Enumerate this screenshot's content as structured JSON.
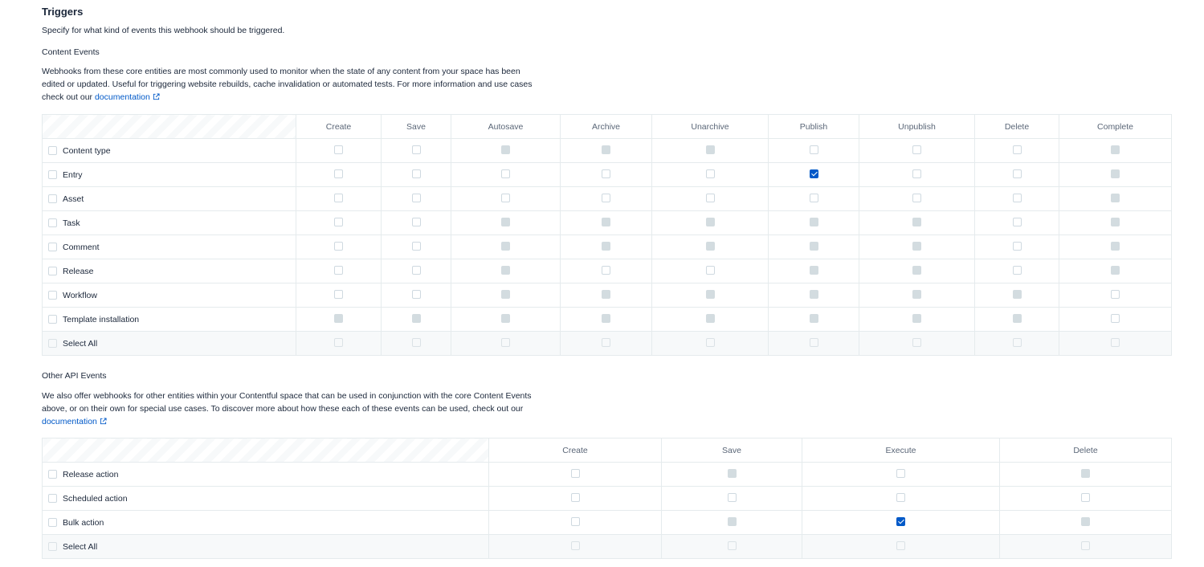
{
  "triggers": {
    "title": "Triggers",
    "subtitle": "Specify for what kind of events this webhook should be triggered."
  },
  "content_events": {
    "title": "Content Events",
    "description": "Webhooks from these core entities are most commonly used to monitor when the state of any content from your space has been edited or updated. Useful for triggering website rebuilds, cache invalidation or automated tests. For more information and use cases check out our",
    "link_label": "documentation",
    "columns": [
      "Create",
      "Save",
      "Autosave",
      "Archive",
      "Unarchive",
      "Publish",
      "Unpublish",
      "Delete",
      "Complete"
    ],
    "rows": [
      {
        "label": "Content type",
        "cells": [
          "off",
          "off",
          "disabled",
          "disabled",
          "disabled",
          "off",
          "off",
          "off",
          "disabled"
        ]
      },
      {
        "label": "Entry",
        "cells": [
          "off",
          "off",
          "off",
          "off",
          "off",
          "checked",
          "off",
          "off",
          "disabled"
        ]
      },
      {
        "label": "Asset",
        "cells": [
          "off",
          "off",
          "off",
          "off",
          "off",
          "off",
          "off",
          "off",
          "disabled"
        ]
      },
      {
        "label": "Task",
        "cells": [
          "off",
          "off",
          "disabled",
          "disabled",
          "disabled",
          "disabled",
          "disabled",
          "off",
          "disabled"
        ]
      },
      {
        "label": "Comment",
        "cells": [
          "off",
          "off",
          "disabled",
          "disabled",
          "disabled",
          "disabled",
          "disabled",
          "off",
          "disabled"
        ]
      },
      {
        "label": "Release",
        "cells": [
          "off",
          "off",
          "disabled",
          "off",
          "off",
          "disabled",
          "disabled",
          "off",
          "disabled"
        ]
      },
      {
        "label": "Workflow",
        "cells": [
          "off",
          "off",
          "disabled",
          "disabled",
          "disabled",
          "disabled",
          "disabled",
          "disabled",
          "off"
        ]
      },
      {
        "label": "Template installation",
        "cells": [
          "disabled",
          "disabled",
          "disabled",
          "disabled",
          "disabled",
          "disabled",
          "disabled",
          "disabled",
          "off"
        ]
      }
    ],
    "select_all_label": "Select All"
  },
  "other_events": {
    "title": "Other API Events",
    "description": "We also offer webhooks for other entities within your Contentful space that can be used in conjunction with the core Content Events above, or on their own for special use cases. To discover more about how these each of these events can be used, check out our",
    "link_label": "documentation",
    "columns": [
      "Create",
      "Save",
      "Execute",
      "Delete"
    ],
    "rows": [
      {
        "label": "Release action",
        "cells": [
          "off",
          "disabled",
          "off",
          "disabled"
        ]
      },
      {
        "label": "Scheduled action",
        "cells": [
          "off",
          "off",
          "off",
          "off"
        ]
      },
      {
        "label": "Bulk action",
        "cells": [
          "off",
          "disabled",
          "checked",
          "disabled"
        ]
      }
    ],
    "select_all_label": "Select All"
  },
  "colors": {
    "accent": "#0059c8",
    "text": "#1b273a",
    "muted": "#5a6677",
    "border": "#e5ebed",
    "disabled": "#d3dce0"
  },
  "icons": {
    "external_link": "external-link-icon",
    "checkbox": "checkbox-icon"
  }
}
